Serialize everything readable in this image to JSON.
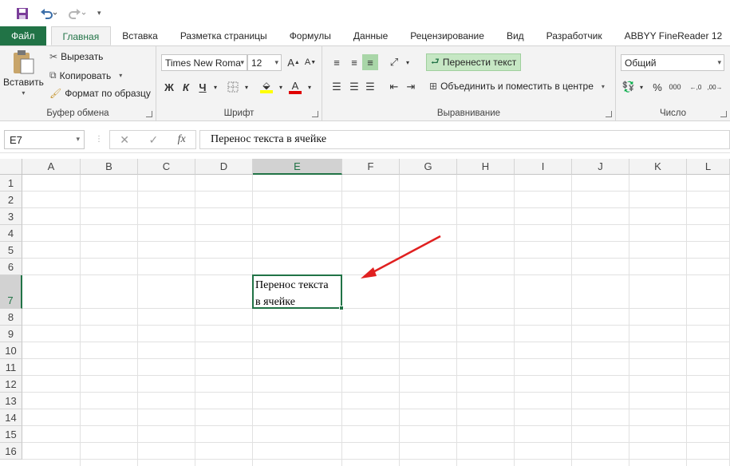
{
  "tabs": [
    "Файл",
    "Главная",
    "Вставка",
    "Разметка страницы",
    "Формулы",
    "Данные",
    "Рецензирование",
    "Вид",
    "Разработчик",
    "ABBYY FineReader 12"
  ],
  "active_tab": "Главная",
  "clipboard": {
    "paste": "Вставить",
    "cut": "Вырезать",
    "copy": "Копировать",
    "format_painter": "Формат по образцу",
    "label": "Буфер обмена"
  },
  "font": {
    "name": "Times New Roma",
    "size": "12",
    "bold": "Ж",
    "italic": "К",
    "underline": "Ч",
    "label": "Шрифт"
  },
  "alignment": {
    "wrap": "Перенести текст",
    "merge": "Объединить и поместить в центре",
    "label": "Выравнивание"
  },
  "number": {
    "format": "Общий",
    "label": "Число"
  },
  "name_box": "E7",
  "formula_fx": "fx",
  "formula": "Перенос текста в ячейке",
  "columns": [
    "A",
    "B",
    "C",
    "D",
    "E",
    "F",
    "G",
    "H",
    "I",
    "J",
    "K",
    "L"
  ],
  "rows": [
    "1",
    "2",
    "3",
    "4",
    "5",
    "6",
    "7",
    "8",
    "9",
    "10",
    "11",
    "12",
    "13",
    "14",
    "15",
    "16"
  ],
  "cell_E7": {
    "line1": "Перенос текста",
    "line2": "в ячейке"
  },
  "colors": {
    "excel_green": "#217346",
    "arrow": "#e02020",
    "wrap_highlight": "#c6e7c4"
  }
}
